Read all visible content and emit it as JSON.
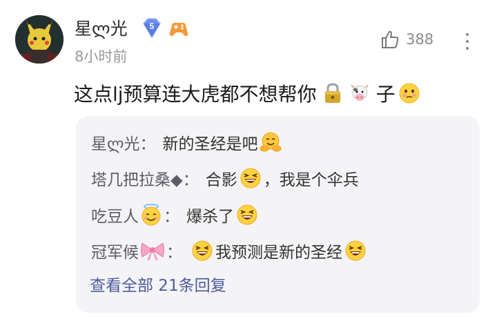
{
  "comment": {
    "author": "星ლ光",
    "level_badge": "5",
    "time": "8小时前",
    "like_count": "388",
    "text_main": "这点lj预算连大虎都不想帮你",
    "text_suffix": "子"
  },
  "replies": [
    {
      "name": "星ლ光",
      "colon": "：",
      "pre": "",
      "text": "新的圣经是吧",
      "name_emoji": "",
      "pre_emoji": "",
      "post_emoji": "hug-emoji"
    },
    {
      "name": "塔几把拉桑◆",
      "colon": "：",
      "pre": "合影",
      "text": "，我是个伞兵",
      "name_emoji": "",
      "pre_emoji": "",
      "post_emoji": "grin-emoji"
    },
    {
      "name": "吃豆人",
      "colon": "：",
      "pre": "",
      "text": "爆杀了",
      "name_emoji": "halo-emoji",
      "pre_emoji": "",
      "post_emoji": "grin-emoji"
    },
    {
      "name": "冠军候",
      "colon": "：",
      "pre": "",
      "text": "我预测是新的圣经",
      "name_emoji": "bow-emoji",
      "pre_emoji": "grin-emoji",
      "post_emoji": "grin-emoji"
    }
  ],
  "view_all": "查看全部 21条回复",
  "icons": {
    "thumb": "thumbs-up-icon",
    "more": "more-vertical-icon",
    "lock": "lock-emoji",
    "cow": "cow-emoji",
    "flushed": "flushed-emoji"
  },
  "colors": {
    "link": "#4f5b9c",
    "reply_bg": "#f4f4f7",
    "meta": "#9a9a9a",
    "level_badge": "#6d8ef0"
  }
}
